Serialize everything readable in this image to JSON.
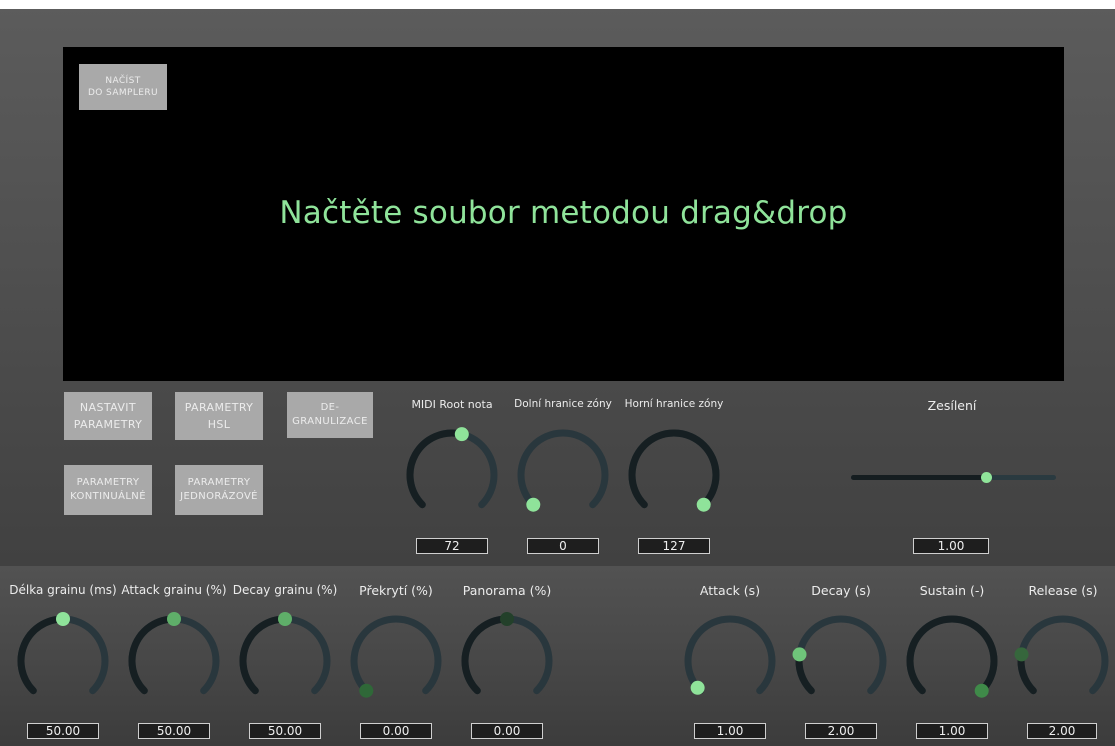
{
  "waveform": {
    "load_button": "NAČÍST\nDO SAMPLERU",
    "drop_hint": "Načtěte soubor metodou drag&drop"
  },
  "mode_buttons": [
    {
      "label": "NASTAVIT\nPARAMETRY"
    },
    {
      "label": "PARAMETRY\nHSL"
    },
    {
      "label": "DE-\nGRANULIZACE"
    },
    {
      "label": "PARAMETRY\nKONTINUÁLNÉ"
    },
    {
      "label": "PARAMETRY\nJEDNORÁZOVÉ"
    }
  ],
  "zone_knobs": [
    {
      "label": "MIDI Root nota",
      "value": "72",
      "level": 0.55
    },
    {
      "label": "Dolní hranice zóny",
      "value": "0",
      "level": 0.0
    },
    {
      "label": "Horní hranice zóny",
      "value": "127",
      "level": 1.0
    }
  ],
  "gain": {
    "label": "Zesílení",
    "value": "1.00",
    "level": 0.66
  },
  "grain_knobs": [
    {
      "label": "Délka grainu (ms)",
      "value": "50.00",
      "level": 0.5,
      "active": true
    },
    {
      "label": "Attack grainu (%)",
      "value": "50.00",
      "level": 0.5,
      "active": true
    },
    {
      "label": "Decay grainu (%)",
      "value": "50.00",
      "level": 0.5,
      "active": true
    },
    {
      "label": "Překrytí (%)",
      "value": "0.00",
      "level": 0.0,
      "active": false
    },
    {
      "label": "Panorama (%)",
      "value": "0.00",
      "level": 0.5,
      "active": false
    }
  ],
  "envelope_knobs": [
    {
      "label": "Attack (s)",
      "value": "1.00",
      "level": 0.02,
      "active": true
    },
    {
      "label": "Decay (s)",
      "value": "2.00",
      "level": 0.2,
      "active": true
    },
    {
      "label": "Sustain (-)",
      "value": "1.00",
      "level": 1.0,
      "active": false
    },
    {
      "label": "Release (s)",
      "value": "2.00",
      "level": 0.2,
      "active": false
    }
  ],
  "colors": {
    "accent": "#8fe39a",
    "accent_dim": "#48874f",
    "accent_dark": "#23402a",
    "knob_track": "#29373d",
    "knob_fill": "#161f22",
    "waveform_bg": "#000000",
    "button_bg": "#a9a9a9"
  }
}
